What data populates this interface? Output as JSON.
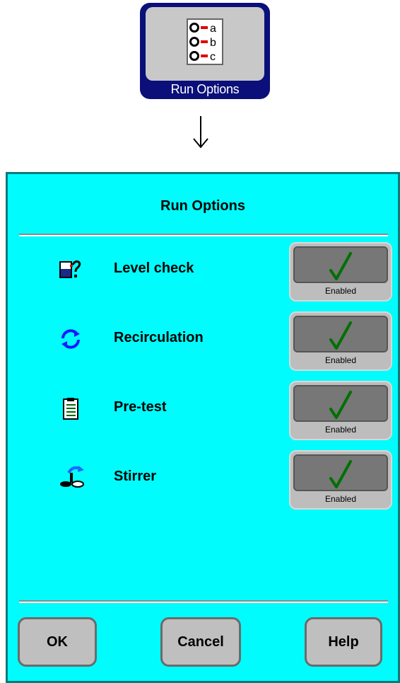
{
  "launcher": {
    "label": "Run Options",
    "icon_letters": [
      "a",
      "b",
      "c"
    ],
    "bg_color": "#0a0f7a"
  },
  "arrow": "down-arrow",
  "dialog": {
    "title": "Run Options",
    "bg_color": "#00fcfc",
    "options": [
      {
        "label": "Level check",
        "icon": "level-check-icon",
        "state": "Enabled",
        "checked": true
      },
      {
        "label": "Recirculation",
        "icon": "recirculation-icon",
        "state": "Enabled",
        "checked": true
      },
      {
        "label": "Pre-test",
        "icon": "pre-test-icon",
        "state": "Enabled",
        "checked": true
      },
      {
        "label": "Stirrer",
        "icon": "stirrer-icon",
        "state": "Enabled",
        "checked": true
      }
    ],
    "buttons": {
      "ok": "OK",
      "cancel": "Cancel",
      "help": "Help"
    }
  }
}
